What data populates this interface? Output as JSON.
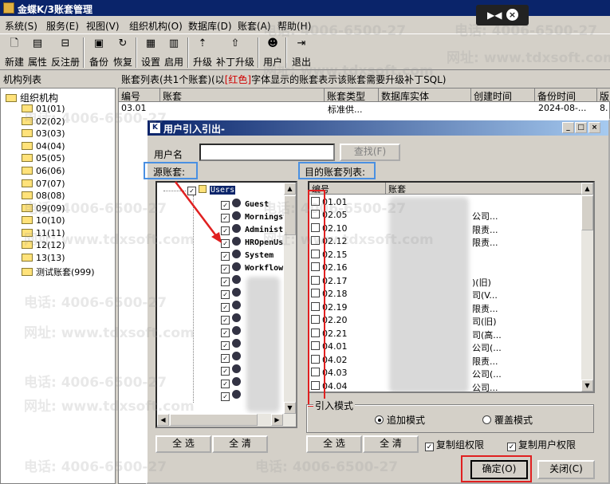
{
  "window": {
    "title": "金蝶K/3账套管理"
  },
  "menu": [
    "系统(S)",
    "服务(E)",
    "视图(V)",
    "组织机构(O)",
    "数据库(D)",
    "账套(A)",
    "帮助(H)"
  ],
  "toolbar": [
    {
      "label": "新建",
      "icon": "new-doc-icon",
      "glyph": "🗋"
    },
    {
      "label": "属性",
      "icon": "properties-icon",
      "glyph": "▤"
    },
    {
      "label": "反注册",
      "icon": "unregister-icon",
      "glyph": "⊟"
    },
    {
      "label": "备份",
      "icon": "backup-icon",
      "glyph": "▣"
    },
    {
      "label": "恢复",
      "icon": "restore-icon",
      "glyph": "↻"
    },
    {
      "label": "设置",
      "icon": "settings-icon",
      "glyph": "▦"
    },
    {
      "label": "启用",
      "icon": "enable-icon",
      "glyph": "▥"
    },
    {
      "label": "升级",
      "icon": "upgrade-icon",
      "glyph": "⇡"
    },
    {
      "label": "补丁升级",
      "icon": "patch-upgrade-icon",
      "glyph": "⇧"
    },
    {
      "label": "用户",
      "icon": "user-icon",
      "glyph": "☻"
    },
    {
      "label": "退出",
      "icon": "exit-icon",
      "glyph": "⇥"
    }
  ],
  "left_panel": {
    "header": "机构列表",
    "root": "组织机构",
    "items": [
      "01(01)",
      "02(02)",
      "03(03)",
      "04(04)",
      "05(05)",
      "06(06)",
      "07(07)",
      "08(08)",
      "09(09)",
      "10(10)",
      "11(11)",
      "12(12)",
      "13(13)",
      "测试账套(999)"
    ]
  },
  "account_list": {
    "header_pre": "账套列表(共1个账套)(以",
    "header_red": "[红色]",
    "header_post": "字体显示的账套表示该账套需要升级补丁SQL)",
    "columns": [
      "编号",
      "账套",
      "账套类型",
      "数据库实体",
      "创建时间",
      "备份时间",
      "版"
    ],
    "row": {
      "id": "03.01",
      "type": "标准供...",
      "backup_time": "2024-08-...",
      "ver": "8."
    }
  },
  "dialog": {
    "title": "用户引入引出-",
    "username_label": "用户名",
    "find_button": "查找(F)",
    "source_label": "源账套:",
    "target_label": "目的账套列表:",
    "source_root": "Users",
    "source_users": [
      "Guest",
      "Morningst",
      "Administ",
      "HROpenUs",
      "System",
      "Workflow"
    ],
    "target_columns": [
      "编号",
      "账套"
    ],
    "target_rows": [
      {
        "id": "01.01",
        "name": ""
      },
      {
        "id": "02.05",
        "name": "公司..."
      },
      {
        "id": "02.10",
        "name": "限责..."
      },
      {
        "id": "02.12",
        "name": "限责..."
      },
      {
        "id": "02.15",
        "name": ""
      },
      {
        "id": "02.16",
        "name": ""
      },
      {
        "id": "02.17",
        "name": ")(旧)"
      },
      {
        "id": "02.18",
        "name": "司(V..."
      },
      {
        "id": "02.19",
        "name": "限责..."
      },
      {
        "id": "02.20",
        "name": "司(旧)"
      },
      {
        "id": "02.21",
        "name": "司(高..."
      },
      {
        "id": "04.01",
        "name": "公司(..."
      },
      {
        "id": "04.02",
        "name": "限责..."
      },
      {
        "id": "04.03",
        "name": "公司(..."
      },
      {
        "id": "04.04",
        "name": "公司..."
      }
    ],
    "import_mode": {
      "title": "引入模式",
      "append": "追加模式",
      "overwrite": "覆盖模式",
      "selected": "append"
    },
    "buttons": {
      "select_all_left": "全 选",
      "clear_left": "全 清",
      "select_all_right": "全 选",
      "clear_right": "全 清",
      "ok": "确定(O)",
      "close": "关闭(C)"
    },
    "copy_org_permissions": "复制组权限",
    "copy_user_permissions": "复制用户权限"
  },
  "watermark": {
    "phone": "电话: 4006-6500-27",
    "site": "网址: www.tdxsoft.com"
  },
  "colors": {
    "titlebar": "#0a246a",
    "annotation_blue": "#4a90e2",
    "annotation_red": "#e02020"
  }
}
